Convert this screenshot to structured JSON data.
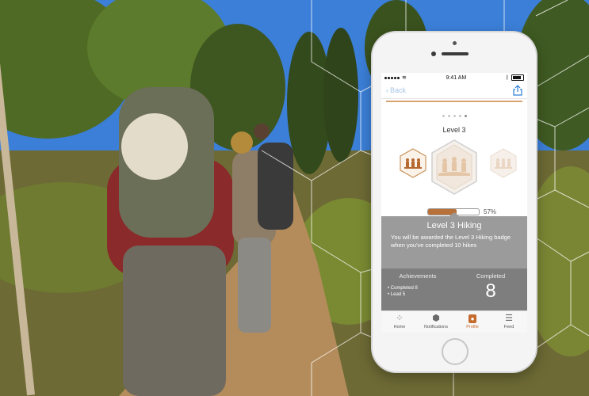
{
  "status_bar": {
    "time": "9:41 AM",
    "carrier_dots": 5
  },
  "nav": {
    "back_label": "Back"
  },
  "level": {
    "title": "Level 3",
    "progress_fraction": 0.57,
    "progress_label": "57%"
  },
  "pager": {
    "count": 5,
    "active_index": 4
  },
  "panel": {
    "title": "Level 3 Hiking",
    "description": "You will be awarded the Level 3 Hiking badge when you've completed 10 hikes",
    "achievements_header": "Achievements",
    "achievements": [
      "• Completed 8",
      "• Lead 5"
    ],
    "completed_header": "Completed",
    "completed_value": "8"
  },
  "tabs": [
    {
      "label": "Home",
      "icon": "home-icon"
    },
    {
      "label": "Notifications",
      "icon": "notifications-icon"
    },
    {
      "label": "Profile",
      "icon": "profile-icon",
      "active": true
    },
    {
      "label": "Feed",
      "icon": "feed-icon"
    }
  ],
  "colors": {
    "accent": "#c56b2e",
    "progress": "#b9713a",
    "panel_top": "#9b9b9b",
    "panel_bottom": "#7e7e7e",
    "link": "#2d7fd6"
  }
}
